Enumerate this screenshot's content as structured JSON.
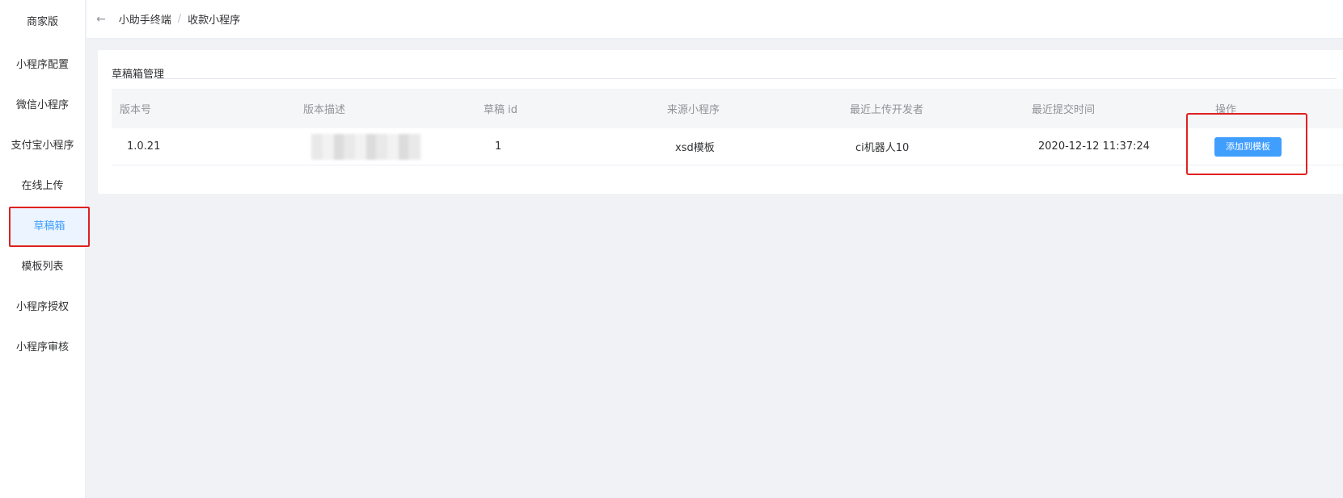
{
  "sidebar": {
    "header": "商家版",
    "items": [
      {
        "label": "小程序配置"
      },
      {
        "label": "微信小程序"
      },
      {
        "label": "支付宝小程序"
      },
      {
        "label": "在线上传"
      },
      {
        "label": "草稿箱",
        "active": true
      },
      {
        "label": "模板列表"
      },
      {
        "label": "小程序授权"
      },
      {
        "label": "小程序审核"
      }
    ]
  },
  "breadcrumb": {
    "parent": "小助手终端",
    "separator": "/",
    "current": "收款小程序"
  },
  "card": {
    "title": "草稿箱管理"
  },
  "table": {
    "columns": [
      "版本号",
      "版本描述",
      "草稿 id",
      "来源小程序",
      "最近上传开发者",
      "最近提交时间",
      "操作"
    ],
    "rows": [
      {
        "version": "1.0.21",
        "description": "",
        "draft_id": "1",
        "source": "xsd模板",
        "developer": "ci机器人10",
        "time": "2020-12-12 11:37:24",
        "action": "添加到模板"
      }
    ]
  },
  "icons": {
    "back": "arrow-left-icon"
  },
  "colors": {
    "primary": "#409eff",
    "highlight": "#e02020",
    "active_bg": "#ecf5ff"
  }
}
